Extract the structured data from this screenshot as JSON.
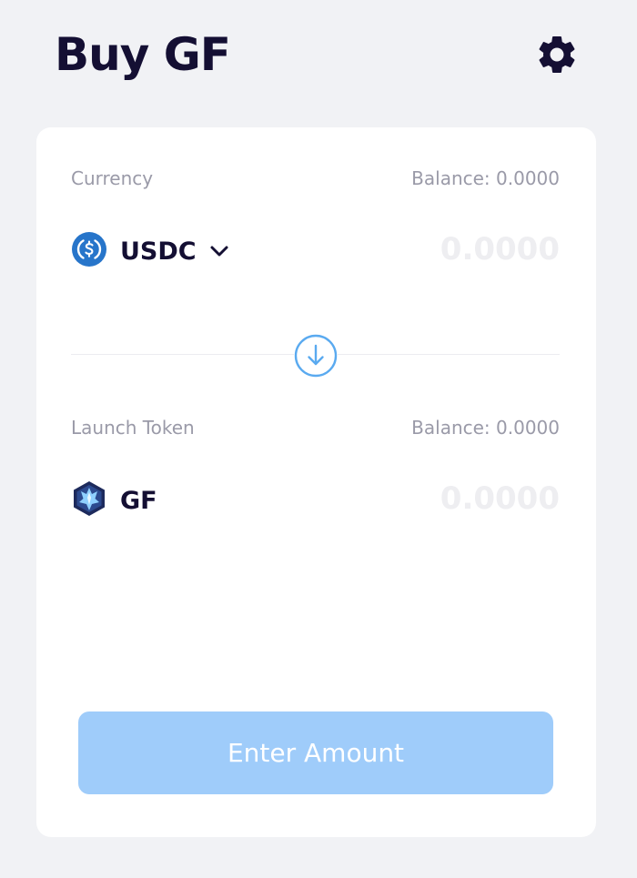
{
  "header": {
    "title": "Buy GF",
    "settings_icon": "gear-icon"
  },
  "from": {
    "label": "Currency",
    "balance": "Balance: 0.0000",
    "token": {
      "symbol": "USDC",
      "icon": "usdc-coin-icon",
      "dropdown_icon": "chevron-down-icon"
    },
    "amount_placeholder": "0.0000"
  },
  "swap": {
    "icon": "arrow-down-circle-icon"
  },
  "to": {
    "label": "Launch Token",
    "balance": "Balance: 0.0000",
    "token": {
      "symbol": "GF",
      "icon": "gf-token-logo-icon"
    },
    "amount_placeholder": "0.0000"
  },
  "action": {
    "button_label": "Enter Amount"
  },
  "colors": {
    "background": "#f1f2f5",
    "card": "#ffffff",
    "title": "#140f33",
    "muted_text": "#9a9aa8",
    "accent": "#5aaaf0",
    "button_disabled": "#9fccfa",
    "usdc_blue": "#2775ca"
  }
}
